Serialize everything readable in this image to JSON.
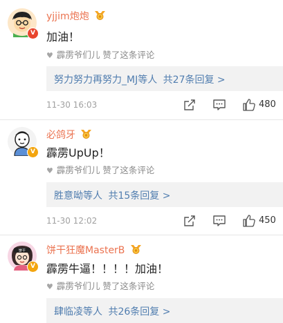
{
  "comments": [
    {
      "username": "yjjim炮炮",
      "content": "加油！",
      "liked_by": "霹雳爷们儿 赞了这条评论",
      "reply_users": "努力努力再努力_MJ等人",
      "reply_count": "共27条回复 >",
      "time": "11-30 16:03",
      "likes": "480",
      "badge": "V",
      "badge_color": "#e8452e"
    },
    {
      "username": "必鸽牙",
      "content": "霹雳UpUp！",
      "liked_by": "霹雳爷们儿 赞了这条评论",
      "reply_users": "胜意呦等人",
      "reply_count": "共15条回复 >",
      "time": "11-30 12:02",
      "likes": "450",
      "badge": "V",
      "badge_color": "#f3a50f"
    },
    {
      "username": "饼干狂魔MasterB",
      "content": "霹雳牛逼！！！！加油！",
      "liked_by": "霹雳爷们儿 赞了这条评论",
      "reply_users": "肆临凌等人",
      "reply_count": "共26条回复 >",
      "badge": "V",
      "badge_color": "#f3a50f"
    }
  ],
  "icons": {
    "heart": "heart-icon",
    "share": "share-icon",
    "comment": "comment-icon",
    "like": "thumbs-up-icon",
    "medal": "medal-icon"
  }
}
